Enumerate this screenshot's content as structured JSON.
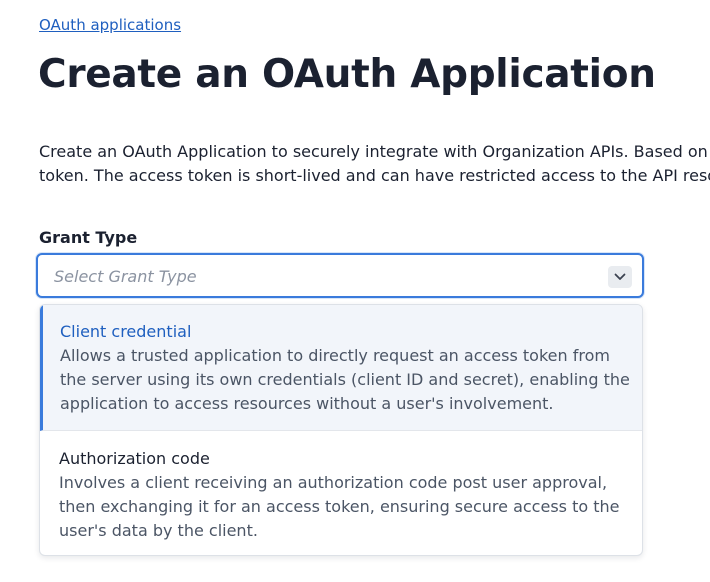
{
  "breadcrumb": {
    "label": "OAuth applications"
  },
  "page": {
    "title": "Create an OAuth Application"
  },
  "description": {
    "line1": "Create an OAuth Application to securely integrate with Organization APIs. Based on th",
    "line2": "token. The access token is short-lived and can have restricted access to the API resou"
  },
  "grant_type": {
    "label": "Grant Type",
    "placeholder": "Select Grant Type",
    "icon": "chevron-down-icon",
    "options": [
      {
        "title": "Client credential",
        "description_lines": [
          "Allows a trusted application to directly request an access token from",
          "the server using its own credentials (client ID and secret), enabling the",
          "application to access resources without a user's involvement."
        ],
        "highlighted": true
      },
      {
        "title": "Authorization code",
        "description_lines": [
          "Involves a client receiving an authorization code post user approval,",
          "then exchanging it for an access token, ensuring secure access to the",
          "user's data by the client."
        ],
        "highlighted": false
      }
    ]
  },
  "colors": {
    "link": "#1f5fbf",
    "focus_border": "#3a7bdc",
    "text": "#1b2130",
    "muted_text": "#4b5565",
    "placeholder": "#8b93a1",
    "highlight_bg": "#f2f5fa"
  }
}
